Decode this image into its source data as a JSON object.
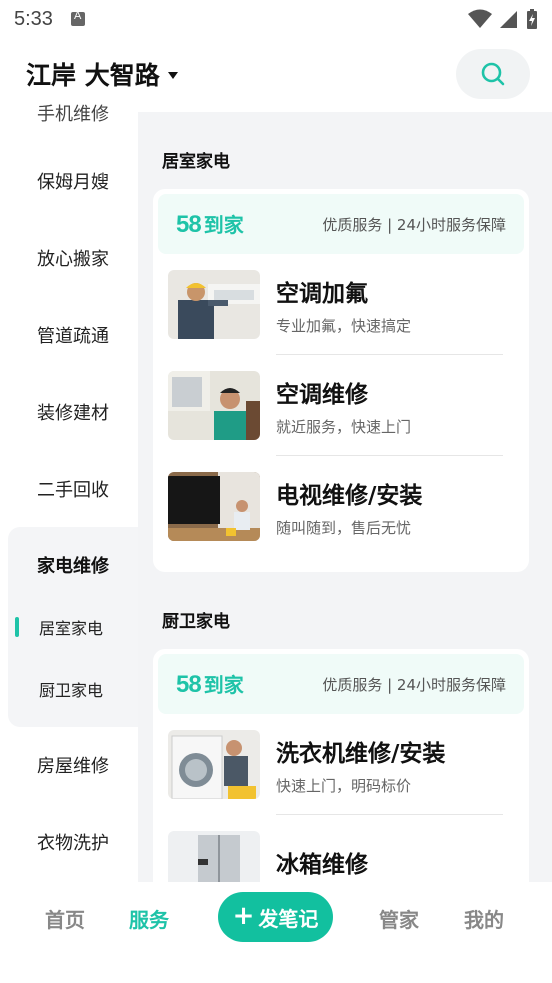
{
  "status_bar": {
    "time": "5:33"
  },
  "header": {
    "location": "江岸 大智路"
  },
  "sidebar": {
    "cut_item": "手机维修",
    "items": [
      "保姆月嫂",
      "放心搬家",
      "管道疏通",
      "装修建材",
      "二手回收"
    ],
    "active_group": "家电维修",
    "sub_items": [
      "居室家电",
      "厨卫家电"
    ],
    "active_sub_index": 0,
    "items_after": [
      "房屋维修",
      "衣物洗护"
    ]
  },
  "content": {
    "sections": [
      {
        "title": "居室家电",
        "banner": {
          "brand_num": "58",
          "brand_text": "到家",
          "slogan": "优质服务 | 24小时服务保障"
        },
        "services": [
          {
            "title": "空调加氟",
            "subtitle": "专业加氟，快速搞定",
            "image": "ac-refill-photo"
          },
          {
            "title": "空调维修",
            "subtitle": "就近服务，快速上门",
            "image": "ac-repair-photo"
          },
          {
            "title": "电视维修/安装",
            "subtitle": "随叫随到，售后无忧",
            "image": "tv-repair-photo"
          }
        ]
      },
      {
        "title": "厨卫家电",
        "banner": {
          "brand_num": "58",
          "brand_text": "到家",
          "slogan": "优质服务 | 24小时服务保障"
        },
        "services": [
          {
            "title": "洗衣机维修/安装",
            "subtitle": "快速上门，明码标价",
            "image": "washer-repair-photo"
          },
          {
            "title": "冰箱维修",
            "subtitle": "",
            "image": "fridge-repair-photo"
          }
        ]
      }
    ]
  },
  "bottom_nav": {
    "home": "首页",
    "service": "服务",
    "post": "发笔记",
    "butler": "管家",
    "mine": "我的",
    "active": "service"
  },
  "colors": {
    "accent": "#1ec3a8",
    "post_button": "#12c09f",
    "content_bg": "#f3f4f6"
  }
}
